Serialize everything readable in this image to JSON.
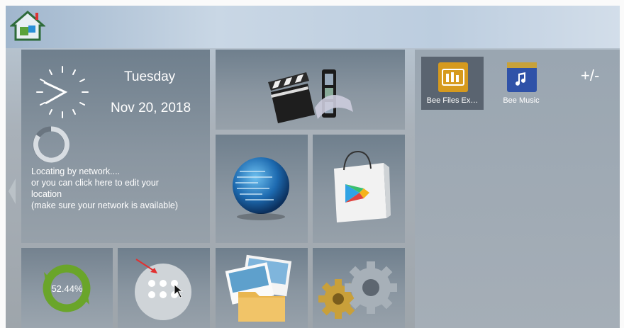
{
  "clock": {
    "day": "Tuesday",
    "date": "Nov 20, 2018"
  },
  "location": {
    "lines": [
      "Locating by network....",
      " or you can click here to edit your",
      "location",
      " (make sure your network is available)"
    ]
  },
  "memory": {
    "percent_text": "52.44%",
    "percent_value": 52.44
  },
  "apps": [
    {
      "label": "Bee Files Ex…",
      "icon": "folder-app-icon",
      "selected": true
    },
    {
      "label": "Bee Music",
      "icon": "music-app-icon",
      "selected": false
    }
  ],
  "panel": {
    "add_remove_label": "+/-"
  },
  "colors": {
    "accent_green": "#6aa52a",
    "store_blue": "#3a5fa6"
  }
}
